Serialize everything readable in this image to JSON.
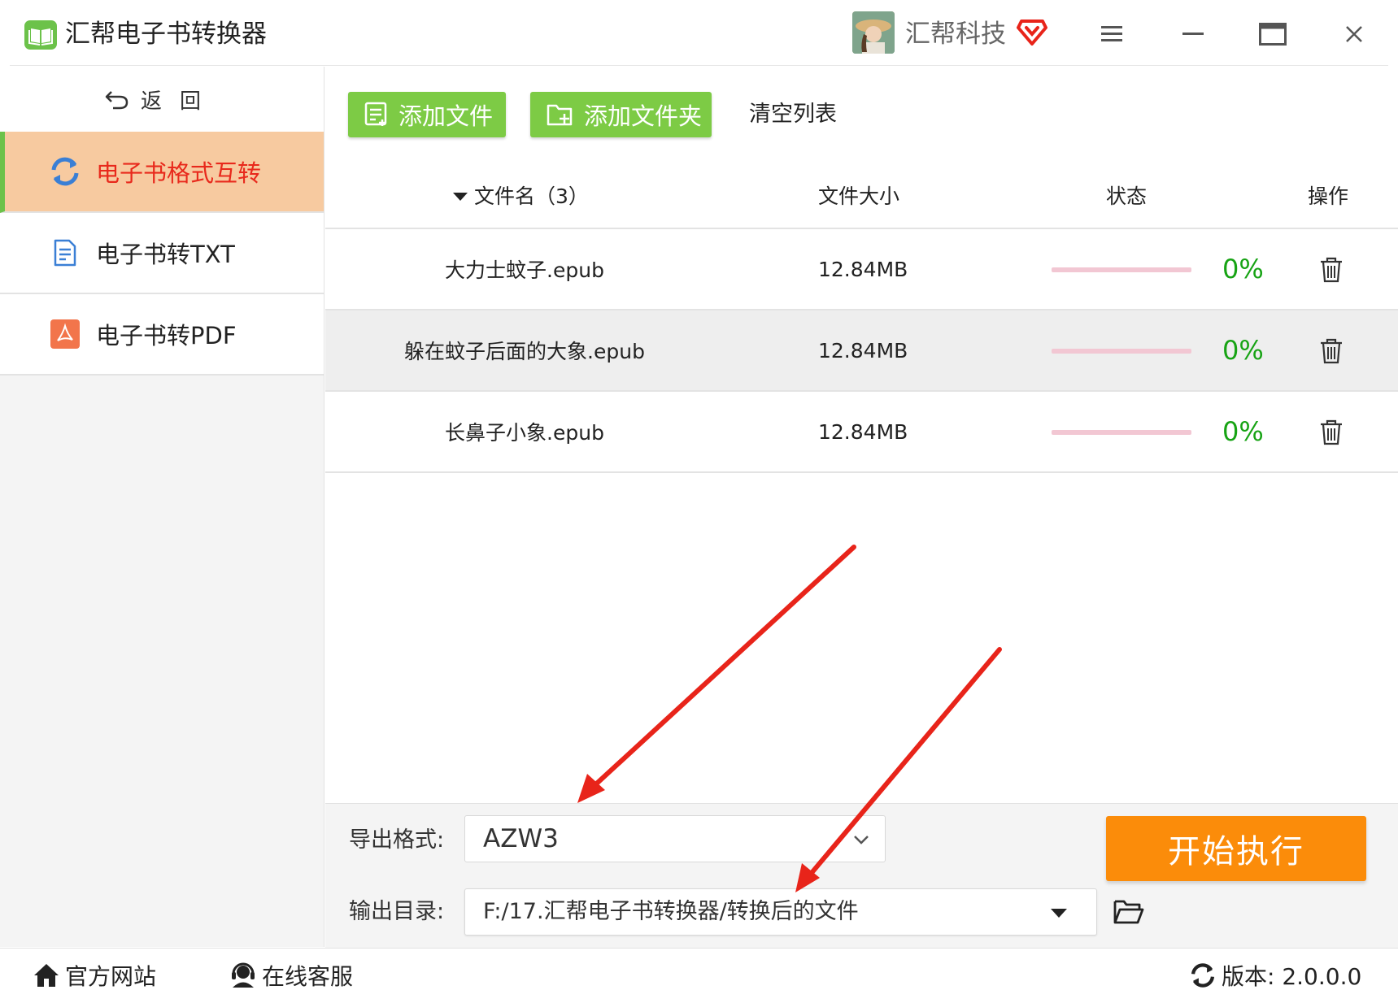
{
  "window": {
    "title": "汇帮电子书转换器",
    "user_name": "汇帮科技",
    "icons": [
      "book-logo-icon",
      "vip-badge-icon",
      "menu-icon",
      "minimize-icon",
      "maximize-icon",
      "close-icon"
    ]
  },
  "sidebar": {
    "back_label": "返回",
    "items": [
      {
        "label": "电子书格式互转",
        "icon": "sync-icon",
        "active": true
      },
      {
        "label": "电子书转TXT",
        "icon": "document-icon",
        "active": false
      },
      {
        "label": "电子书转PDF",
        "icon": "pdf-icon",
        "active": false
      }
    ]
  },
  "toolbar": {
    "add_file": "添加文件",
    "add_folder": "添加文件夹",
    "clear_list": "清空列表"
  },
  "table": {
    "headers": {
      "name": "文件名（3）",
      "size": "文件大小",
      "status": "状态",
      "action": "操作"
    },
    "rows": [
      {
        "name": "大力士蚊子.epub",
        "size": "12.84MB",
        "progress": 0,
        "percent": "0%"
      },
      {
        "name": "躲在蚊子后面的大象.epub",
        "size": "12.84MB",
        "progress": 0,
        "percent": "0%"
      },
      {
        "name": "长鼻子小象.epub",
        "size": "12.84MB",
        "progress": 0,
        "percent": "0%"
      }
    ]
  },
  "bottom": {
    "format_label": "导出格式:",
    "format_value": "AZW3",
    "dir_label": "输出目录:",
    "dir_value": "F:/17.汇帮电子书转换器/转换后的文件",
    "start_label": "开始执行"
  },
  "statusbar": {
    "website": "官方网站",
    "support": "在线客服",
    "version": "版本:  2.0.0.0"
  },
  "colors": {
    "accent_green": "#7dcb45",
    "active_bg": "#f7caa0",
    "active_text": "#e8291c",
    "start_orange": "#fb8c0a",
    "percent_green": "#17a314",
    "annotation_red": "#e8241a"
  }
}
